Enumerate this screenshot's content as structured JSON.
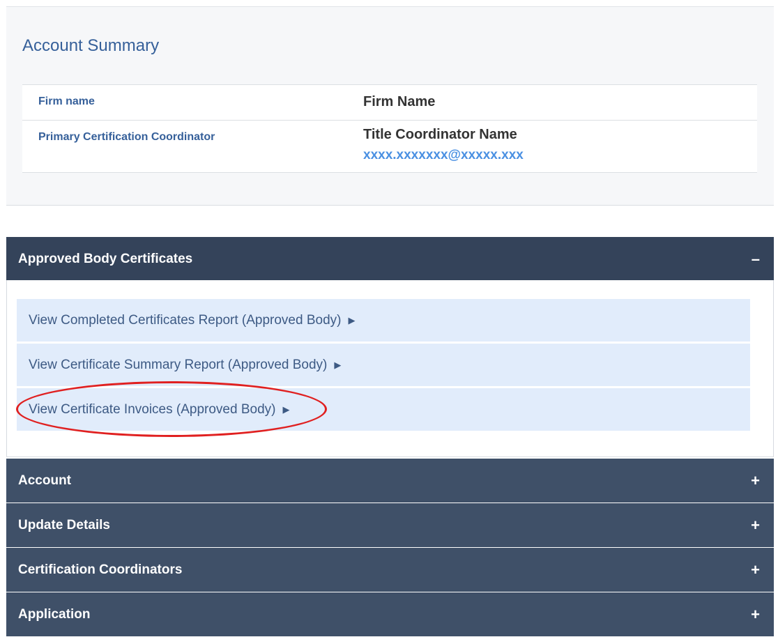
{
  "account_summary": {
    "title": "Account Summary",
    "rows": [
      {
        "label": "Firm name",
        "value": "Firm Name"
      },
      {
        "label": "Primary Certification Coordinator",
        "value": "Title Coordinator Name",
        "email": "xxxx.xxxxxxx@xxxxx.xxx"
      }
    ]
  },
  "panels": [
    {
      "title": "Approved Body Certificates",
      "toggle": "–",
      "expanded": true,
      "links": [
        {
          "label": "View Completed Certificates Report (Approved Body)",
          "arrow": "▶"
        },
        {
          "label": "View Certificate Summary Report (Approved Body)",
          "arrow": "▶"
        },
        {
          "label": "View Certificate Invoices (Approved Body)",
          "arrow": "▶"
        }
      ]
    },
    {
      "title": "Account",
      "toggle": "+"
    },
    {
      "title": "Update Details",
      "toggle": "+"
    },
    {
      "title": "Certification Coordinators",
      "toggle": "+"
    },
    {
      "title": "Application",
      "toggle": "+"
    }
  ],
  "colors": {
    "header_bg": "#34435a",
    "link_bg": "#e1ecfb",
    "accent_blue": "#36609a",
    "email_blue": "#4a90e2",
    "highlight_red": "#e02020"
  }
}
